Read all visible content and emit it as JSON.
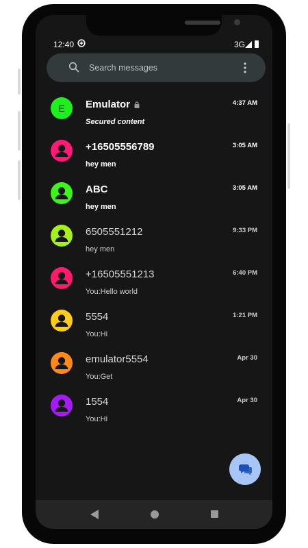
{
  "status_bar": {
    "time": "12:40",
    "network": "3G"
  },
  "search": {
    "placeholder": "Search messages"
  },
  "conversations": [
    {
      "name": "Emulator",
      "snippet": "Secured content",
      "time": "4:37 AM",
      "unread": true,
      "avatar_letter": "E",
      "avatar_color": "#1ef01e",
      "locked": true
    },
    {
      "name": "+16505556789",
      "snippet": "hey men",
      "time": "3:05 AM",
      "unread": true,
      "avatar_color": "#ff1a78"
    },
    {
      "name": "ABC",
      "snippet": "hey men",
      "time": "3:05 AM",
      "unread": true,
      "avatar_color": "#3df51a"
    },
    {
      "name": "6505551212",
      "snippet": "hey men",
      "time": "9:33 PM",
      "unread": false,
      "avatar_color": "#a6f01e"
    },
    {
      "name": "+16505551213",
      "snippet": "You:Hello world",
      "time": "6:40 PM",
      "unread": false,
      "avatar_color": "#ff1a6e"
    },
    {
      "name": "5554",
      "snippet": "You:Hi",
      "time": "1:21 PM",
      "unread": false,
      "avatar_color": "#ffcc1a"
    },
    {
      "name": "emulator5554",
      "snippet": "You:Get",
      "time": "Apr 30",
      "unread": false,
      "avatar_color": "#ff8a1a"
    },
    {
      "name": "1554",
      "snippet": "You:Hi",
      "time": "Apr 30",
      "unread": false,
      "avatar_color": "#a51af5"
    }
  ],
  "icons": {
    "search": "search-icon",
    "more": "more-vert-icon",
    "fab": "chat-icon",
    "lock": "lock-icon"
  },
  "colors": {
    "fab_background": "#a8c6f5",
    "fab_icon": "#1f4fb8",
    "background": "#161616"
  }
}
